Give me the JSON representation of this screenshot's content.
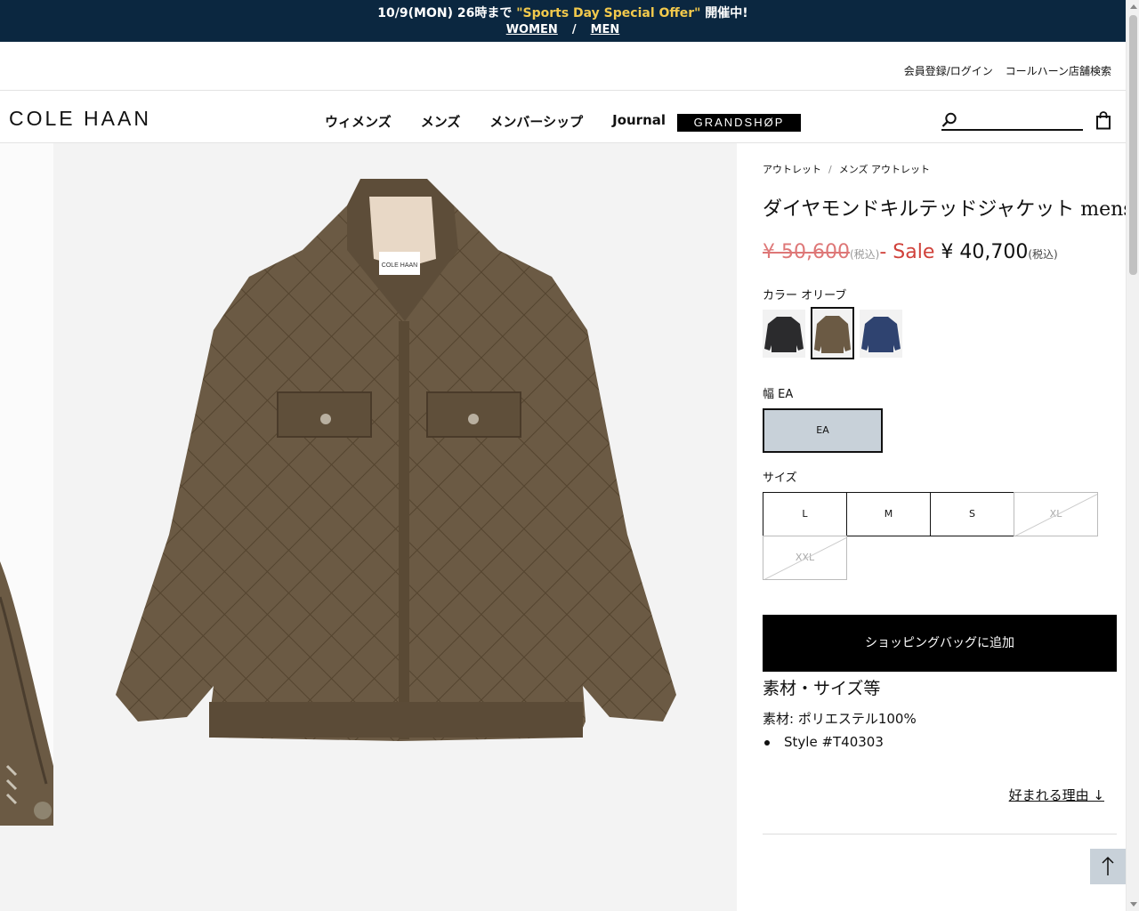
{
  "promo": {
    "prefix": "10/9(MON) 26時まで ",
    "highlight": "\"Sports Day Special Offer\"",
    "suffix": " 開催中!",
    "women_link": "WOMEN",
    "separator": "/",
    "men_link": "MEN"
  },
  "utility": {
    "register_login": "会員登録/ログイン",
    "store_search": "コールハーン店舗検索"
  },
  "nav": {
    "logo": "COLE HAAN",
    "items": [
      "ウィメンズ",
      "メンズ",
      "メンバーシップ",
      "Journal"
    ],
    "grandshop": "GRANDSHØP",
    "search_placeholder": ""
  },
  "product": {
    "breadcrumb": [
      "アウトレット",
      "メンズ アウトレット"
    ],
    "breadcrumb_sep": "/",
    "title": "ダイヤモンドキルテッドジャケット mens",
    "original_price": "¥ 50,600",
    "original_tax": "(税込)",
    "dash": "- ",
    "sale_label": "Sale",
    "sale_price": "¥ 40,700",
    "sale_tax": "(税込)",
    "color_label": "カラー オリーブ",
    "colors": [
      {
        "name": "black",
        "hex": "#2b2b2d"
      },
      {
        "name": "olive",
        "hex": "#6b5a44"
      },
      {
        "name": "navy",
        "hex": "#2f4370"
      }
    ],
    "selected_color_index": 1,
    "width_label": "幅 EA",
    "width_option": "EA",
    "size_label": "サイズ",
    "sizes": [
      {
        "label": "L",
        "available": true
      },
      {
        "label": "M",
        "available": true
      },
      {
        "label": "S",
        "available": true
      },
      {
        "label": "XL",
        "available": false
      },
      {
        "label": "XXL",
        "available": false
      }
    ],
    "add_to_bag": "ショッピングバッグに追加",
    "materials_title": "素材・サイズ等",
    "material": "素材: ポリエステル100%",
    "style": "Style #T40303",
    "why_loved": "好まれる理由 ↓"
  },
  "colors": {
    "banner_bg": "#0b2740",
    "promo_highlight": "#f2c94c",
    "sale_red": "#d0413a",
    "selected_width_bg": "#c8d1d9",
    "jacket_olive": "#6b5a44"
  }
}
